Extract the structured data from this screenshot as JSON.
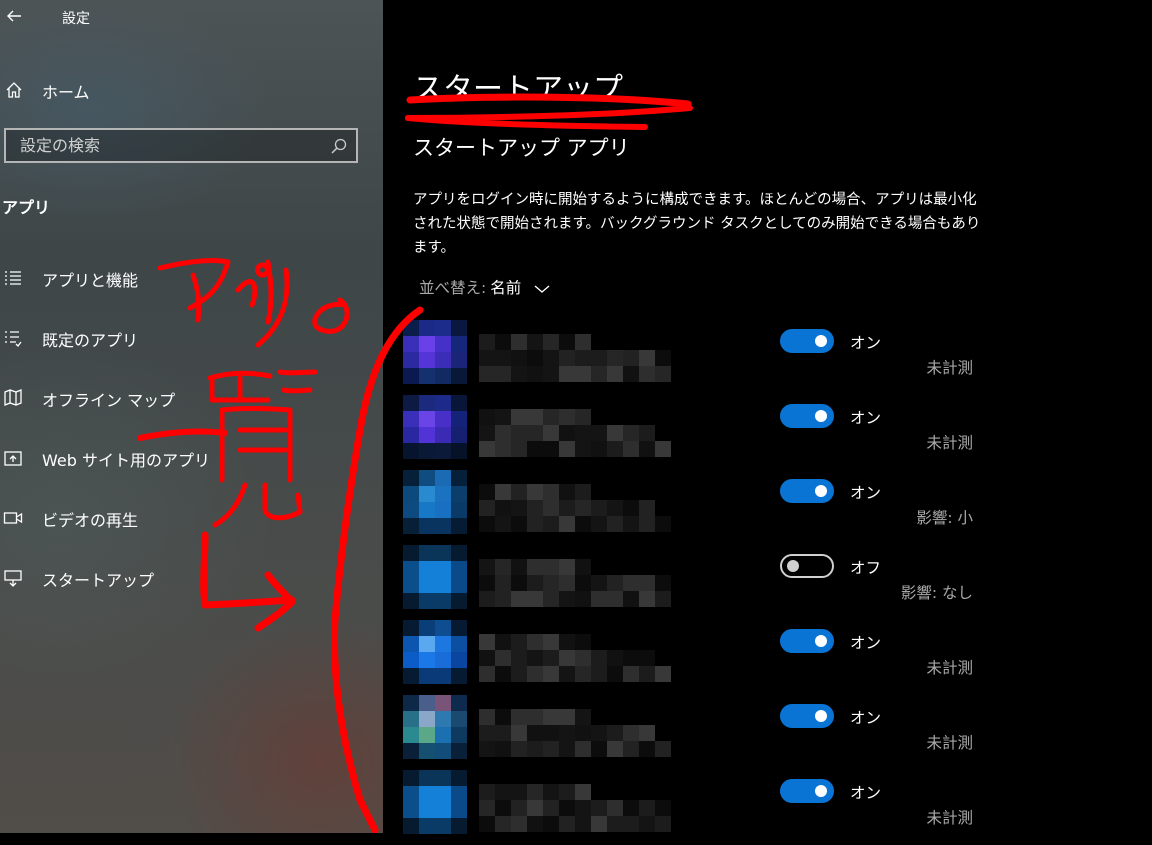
{
  "window": {
    "title": "設定"
  },
  "sidebar": {
    "home_label": "ホーム",
    "search_placeholder": "設定の検索",
    "section_heading": "アプリ",
    "items": [
      {
        "label": "アプリと機能",
        "icon": "list-icon"
      },
      {
        "label": "既定のアプリ",
        "icon": "default-apps-icon"
      },
      {
        "label": "オフライン マップ",
        "icon": "map-icon"
      },
      {
        "label": "Web サイト用のアプリ",
        "icon": "web-app-icon"
      },
      {
        "label": "ビデオの再生",
        "icon": "video-icon"
      },
      {
        "label": "スタートアップ",
        "icon": "startup-icon"
      }
    ]
  },
  "main": {
    "page_title": "スタートアップ",
    "subheading": "スタートアップ アプリ",
    "description": "アプリをログイン時に開始するように構成できます。ほとんどの場合、アプリは最小化された状態で開始されます。バックグラウンド タスクとしてのみ開始できる場合もあります。",
    "sort_label": "並べ替え:",
    "sort_value": "名前",
    "apps": [
      {
        "state": "オン",
        "on": true,
        "impact": "未計測"
      },
      {
        "state": "オン",
        "on": true,
        "impact": "未計測"
      },
      {
        "state": "オン",
        "on": true,
        "impact": "影響: 小"
      },
      {
        "state": "オフ",
        "on": false,
        "impact": "影響: なし"
      },
      {
        "state": "オン",
        "on": true,
        "impact": "未計測"
      },
      {
        "state": "オン",
        "on": true,
        "impact": "未計測"
      },
      {
        "state": "オン",
        "on": true,
        "impact": "未計測"
      }
    ]
  },
  "annotation": {
    "text": "アプリの一覧",
    "color": "#ff0000"
  },
  "colors": {
    "accent": "#0a74d4",
    "background": "#000000",
    "secondary_text": "#a8a8a8"
  }
}
